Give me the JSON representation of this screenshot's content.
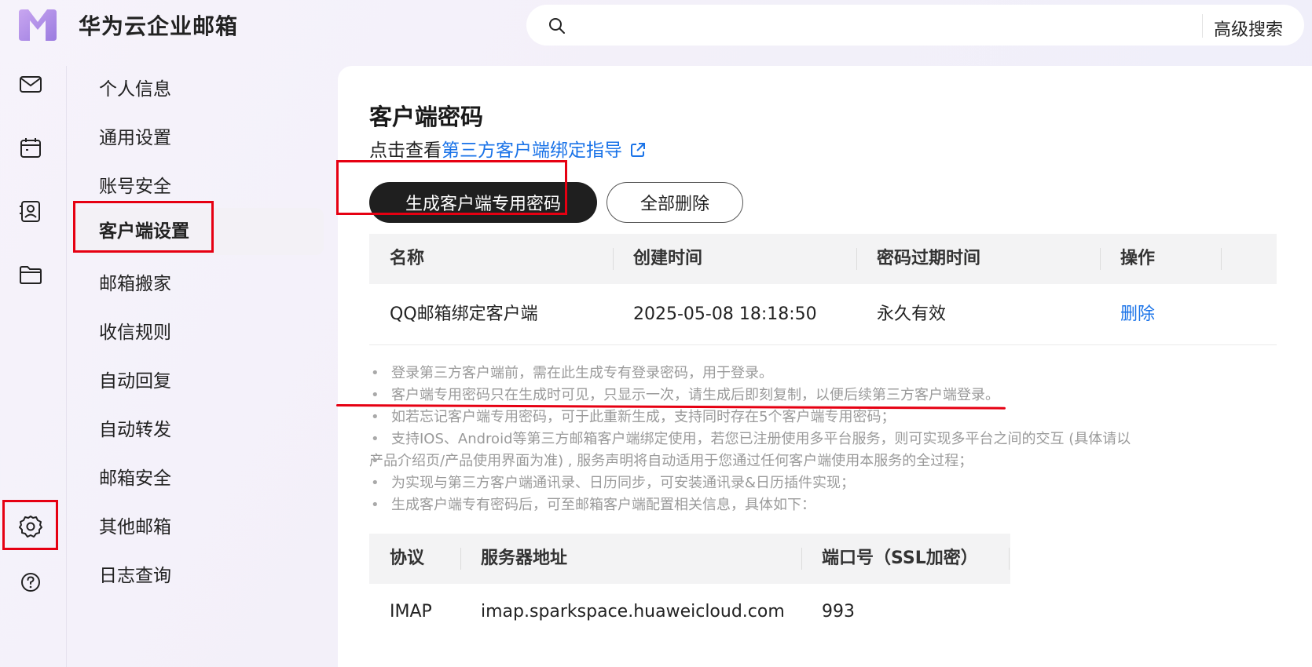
{
  "app": {
    "title": "华为云企业邮箱"
  },
  "search": {
    "placeholder": "",
    "advanced_label": "高级搜索"
  },
  "rail": {
    "icons": [
      "mail-icon",
      "calendar-icon",
      "contacts-icon",
      "folder-icon",
      "settings-icon",
      "help-icon"
    ]
  },
  "nav": {
    "items": [
      {
        "label": "个人信息"
      },
      {
        "label": "通用设置"
      },
      {
        "label": "账号安全"
      },
      {
        "label": "客户端设置"
      },
      {
        "label": "邮箱搬家"
      },
      {
        "label": "收信规则"
      },
      {
        "label": "自动回复"
      },
      {
        "label": "自动转发"
      },
      {
        "label": "邮箱安全"
      },
      {
        "label": "其他邮箱"
      },
      {
        "label": "日志查询"
      }
    ],
    "active": "客户端设置"
  },
  "main": {
    "title": "客户端密码",
    "guide_prefix": "点击查看",
    "guide_link": "第三方客户端绑定指导",
    "generate_button": "生成客户端专用密码",
    "delete_all_button": "全部删除",
    "table": {
      "headers": [
        "名称",
        "创建时间",
        "密码过期时间",
        "操作"
      ],
      "rows": [
        {
          "name": "QQ邮箱绑定客户端",
          "created": "2025-05-08 18:18:50",
          "expires": "永久有效",
          "action": "删除"
        }
      ]
    },
    "notes": [
      "登录第三方客户端前，需在此生成专有登录密码，用于登录。",
      "客户端专用密码只在生成时可见，只显示一次，请生成后即刻复制，以便后续第三方客户端登录。",
      "如若忘记客户端专用密码，可于此重新生成，支持同时存在5个客户端专用密码；",
      "支持IOS、Android等第三方邮箱客户端绑定使用，若您已注册使用多平台服务，则可实现多平台之间的交互 (具体请以",
      "产品介绍页/产品使用界面为准) , 服务声明将自动适用于您通过任何客户端使用本服务的全过程；",
      "为实现与第三方客户端通讯录、日历同步，可安装通讯录&日历插件实现；",
      "生成客户端专有密码后，可至邮箱客户端配置相关信息，具体如下："
    ],
    "server_table": {
      "headers": [
        "协议",
        "服务器地址",
        "端口号（SSL加密）"
      ],
      "rows": [
        {
          "protocol": "IMAP",
          "server": "imap.sparkspace.huaweicloud.com",
          "port": "993"
        }
      ]
    }
  },
  "colors": {
    "accent_link": "#1a73e8",
    "highlight_red": "#e60012",
    "primary_button": "#1f1f1f",
    "logo_purple": "#b08ee8"
  }
}
